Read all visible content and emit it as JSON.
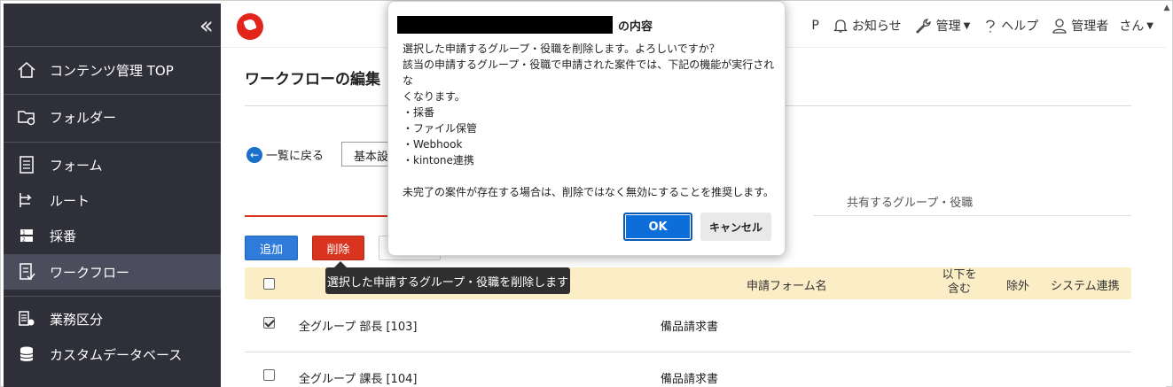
{
  "sidebar": {
    "items": [
      {
        "label": "コンテンツ管理 TOP",
        "icon": "home-icon"
      },
      {
        "label": "フォルダー",
        "icon": "folder-gear-icon"
      },
      {
        "label": "フォーム",
        "icon": "form-icon"
      },
      {
        "label": "ルート",
        "icon": "route-icon"
      },
      {
        "label": "採番",
        "icon": "numbering-icon"
      },
      {
        "label": "ワークフロー",
        "icon": "workflow-icon"
      },
      {
        "label": "業務区分",
        "icon": "business-category-icon"
      },
      {
        "label": "カスタムデータベース",
        "icon": "database-icon"
      }
    ]
  },
  "topnav": {
    "partial_label": "P",
    "notice": "お知らせ",
    "admin": "管理",
    "help": "ヘルプ",
    "user_role": "管理者",
    "user_suffix": "さん"
  },
  "main": {
    "title": "ワークフローの編集",
    "back_label": "一覧に戻る",
    "tab_basic": "基本設",
    "shared_label": "共有するグループ・役職",
    "add_label": "追加",
    "delete_label": "削除",
    "table": {
      "headers": {
        "form": "申請フォーム名",
        "subordinate_line1": "以下を",
        "subordinate_line2": "含む",
        "exclude": "除外",
        "system": "システム連携"
      },
      "rows": [
        {
          "group": "全グループ 部長 [103]",
          "form": "備品請求書",
          "checked": true
        },
        {
          "group": "全グループ 課長 [104]",
          "form": "備品請求書",
          "checked": false
        }
      ]
    },
    "tooltip": "選択した申請するグループ・役職を削除します"
  },
  "dialog": {
    "title_suffix": "の内容",
    "line1": "選択した申請するグループ・役職を削除します。よろしいですか？",
    "line2": "該当の申請するグループ・役職で申請された案件では、下記の機能が実行されな",
    "line3": "くなります。",
    "bullet1": "・採番",
    "bullet2": "・ファイル保管",
    "bullet3": "・Webhook",
    "bullet4": "・kintone連携",
    "line4": "未完了の案件が存在する場合は、削除ではなく無効にすることを推奨します。",
    "ok_label": "OK",
    "cancel_label": "キャンセル"
  },
  "colors": {
    "sidebar_bg": "#2e2f38",
    "accent_blue": "#0d6ed9",
    "danger_red": "#d9341f",
    "table_header_bg": "#fbedc6"
  }
}
